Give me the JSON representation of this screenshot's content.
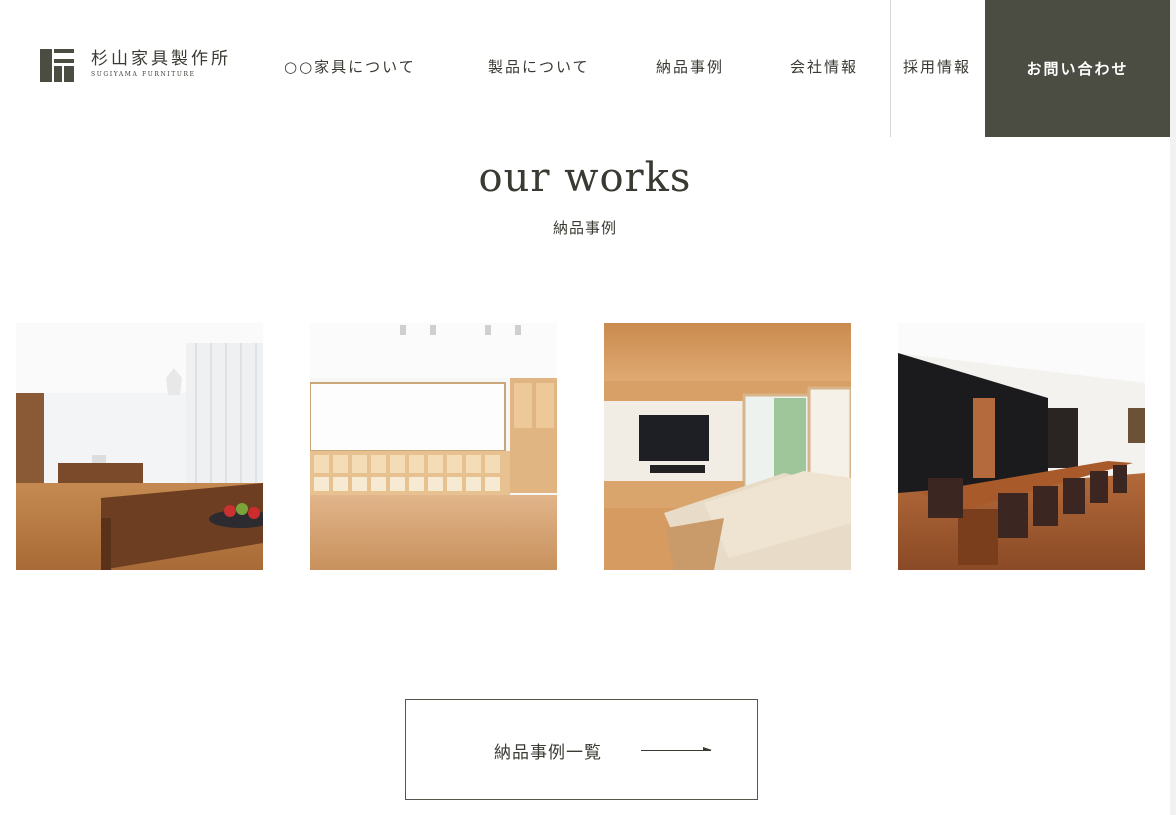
{
  "brand": {
    "name_jp": "杉山家具製作所",
    "name_en": "SUGIYAMA FURNITURE"
  },
  "nav": {
    "items": [
      {
        "label": "○○家具について"
      },
      {
        "label": "製品について"
      },
      {
        "label": "納品事例"
      },
      {
        "label": "会社情報"
      },
      {
        "label": "採用情報"
      }
    ],
    "contact_label": "お問い合わせ"
  },
  "section": {
    "title": "our works",
    "subtitle": "納品事例"
  },
  "works": [
    {
      "icon": "dining-room-photo"
    },
    {
      "icon": "kids-room-shelves-photo"
    },
    {
      "icon": "living-room-tv-sofa-photo"
    },
    {
      "icon": "long-dining-table-photo"
    }
  ],
  "view_all": {
    "label": "納品事例一覧"
  },
  "colors": {
    "accent": "#4c4d42",
    "text": "#3a3a33",
    "wood": "#b87a45"
  }
}
